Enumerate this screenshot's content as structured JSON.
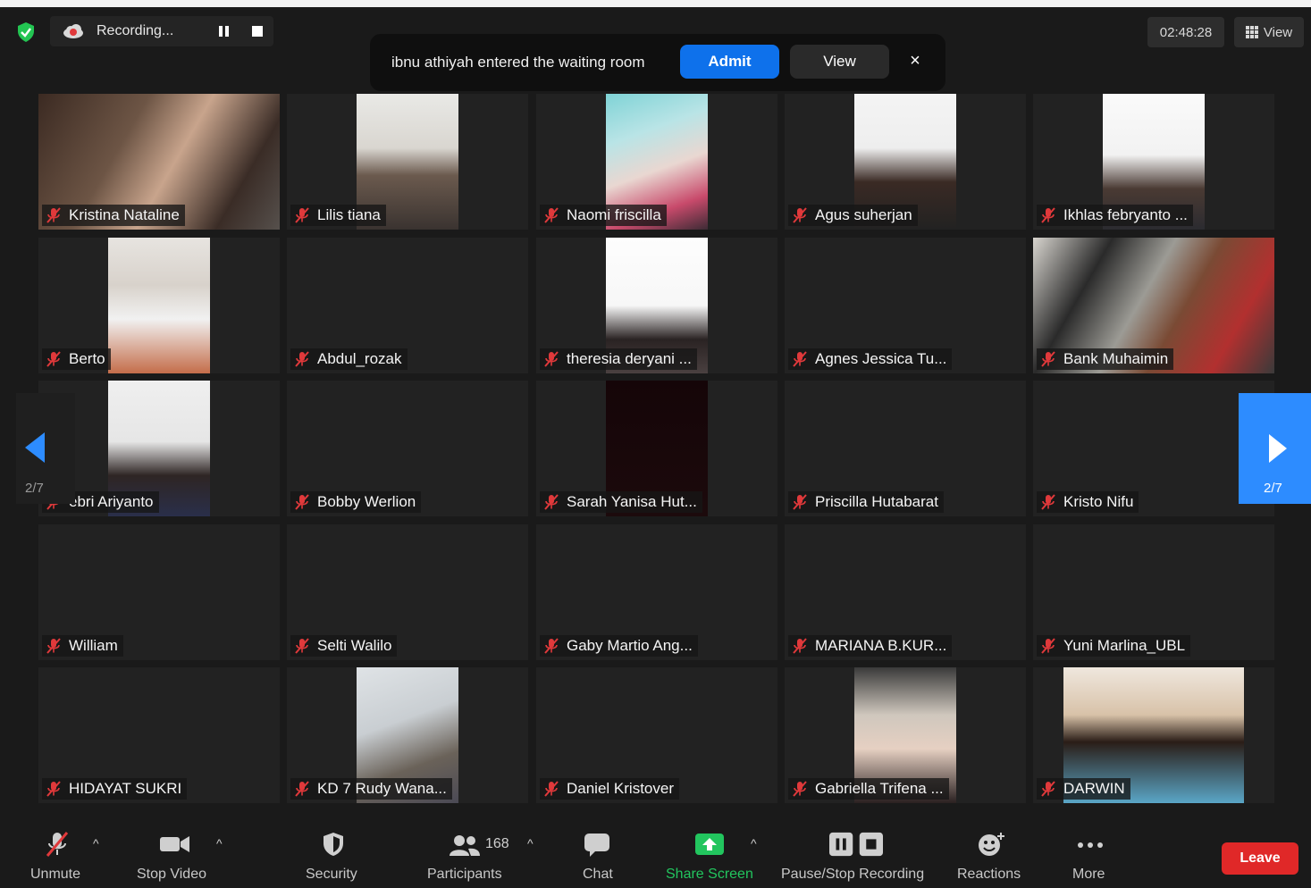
{
  "recording": {
    "label": "Recording..."
  },
  "notification": {
    "message": "ibnu athiyah entered the waiting room",
    "admit_label": "Admit",
    "view_label": "View",
    "close_glyph": "×"
  },
  "timer": "02:48:28",
  "view_button": "View",
  "pagination": {
    "left": "2/7",
    "right": "2/7"
  },
  "participants": [
    {
      "name": "Kristina Nataline"
    },
    {
      "name": "Lilis tiana"
    },
    {
      "name": "Naomi friscilla"
    },
    {
      "name": "Agus suherjan"
    },
    {
      "name": "Ikhlas febryanto ..."
    },
    {
      "name": "Berto"
    },
    {
      "name": "Abdul_rozak"
    },
    {
      "name": "theresia deryani ..."
    },
    {
      "name": "Agnes Jessica Tu..."
    },
    {
      "name": "Bank Muhaimin"
    },
    {
      "name": "ebri Ariyanto"
    },
    {
      "name": "Bobby Werlion"
    },
    {
      "name": "Sarah Yanisa Hut..."
    },
    {
      "name": "Priscilla Hutabarat"
    },
    {
      "name": "Kristo Nifu"
    },
    {
      "name": "William"
    },
    {
      "name": "Selti Walilo"
    },
    {
      "name": "Gaby Martio Ang..."
    },
    {
      "name": "MARIANA B.KUR..."
    },
    {
      "name": "Yuni Marlina_UBL"
    },
    {
      "name": "HIDAYAT SUKRI"
    },
    {
      "name": "KD 7 Rudy Wana..."
    },
    {
      "name": "Daniel Kristover"
    },
    {
      "name": "Gabriella Trifena ..."
    },
    {
      "name": "DARWIN"
    }
  ],
  "toolbar": {
    "unmute": "Unmute",
    "stop_video": "Stop Video",
    "security": "Security",
    "participants": "Participants",
    "participants_count": "168",
    "chat": "Chat",
    "share_screen": "Share Screen",
    "pause_stop_recording": "Pause/Stop Recording",
    "reactions": "Reactions",
    "more": "More",
    "leave": "Leave",
    "caret_glyph": "^"
  },
  "colors": {
    "accent_blue": "#0e71eb",
    "share_green": "#22c55e",
    "leave_red": "#e02828",
    "muted_red": "#e0393b"
  }
}
